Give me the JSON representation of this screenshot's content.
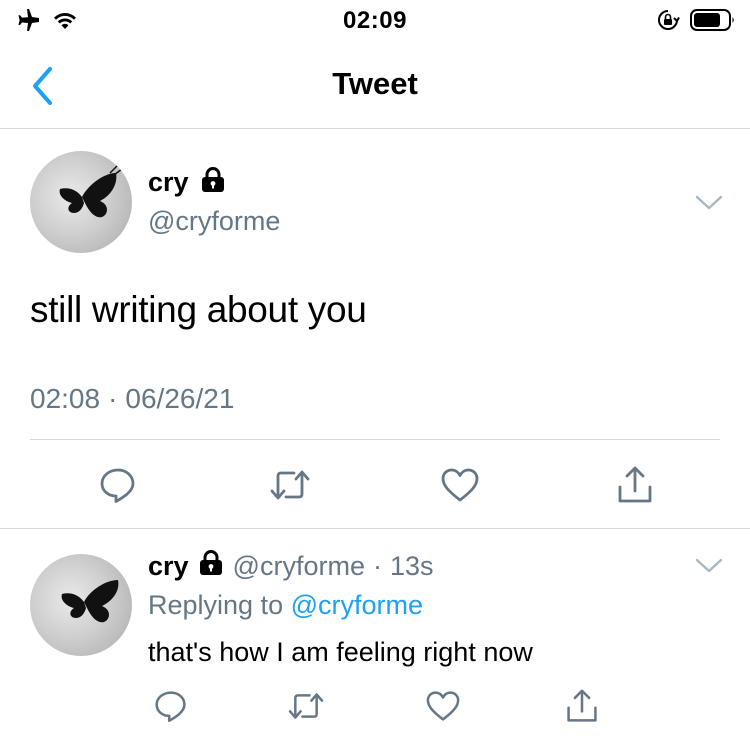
{
  "status_bar": {
    "time": "02:09",
    "left_icons": [
      "airplane-icon",
      "wifi-icon"
    ],
    "right_icons": [
      "orientation-lock-icon",
      "battery-icon"
    ]
  },
  "nav": {
    "title": "Tweet",
    "back_icon": "chevron-left-icon"
  },
  "main_tweet": {
    "display_name": "cry",
    "handle": "@cryforme",
    "text": "still writing about you",
    "time": "02:08",
    "separator": "·",
    "date": "06/26/21",
    "actions": [
      "reply-icon",
      "retweet-icon",
      "like-icon",
      "share-icon"
    ]
  },
  "reply_tweet": {
    "display_name": "cry",
    "handle": "@cryforme",
    "separator": "·",
    "age": "13s",
    "replying_to_label": "Replying to",
    "replying_to_handle": "@cryforme",
    "text": "that's how I am feeling right now",
    "actions": [
      "reply-icon",
      "retweet-icon",
      "like-icon",
      "share-icon"
    ]
  },
  "colors": {
    "accent": "#1da1f2",
    "secondary_text": "#657786",
    "divider": "#d6d9dc",
    "icon_gray": "#657786"
  }
}
